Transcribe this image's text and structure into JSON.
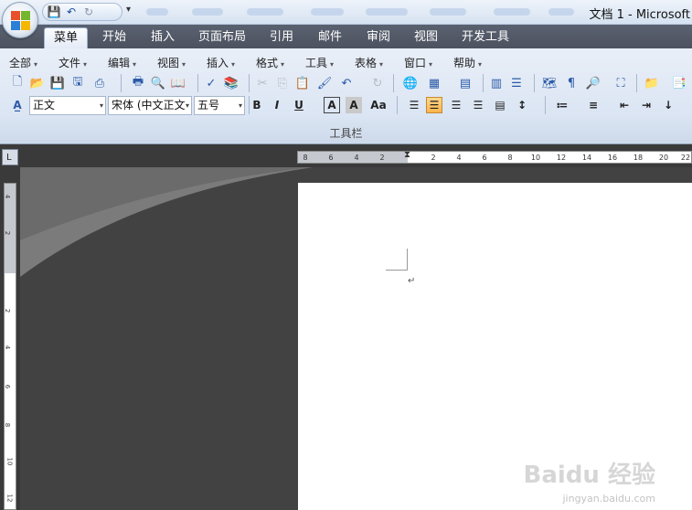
{
  "title_bar": {
    "window_title": "文档 1 - Microsoft",
    "qat_icons": [
      "save-icon",
      "undo-icon",
      "redo-icon"
    ]
  },
  "tabs": [
    {
      "label": "菜单",
      "active": true
    },
    {
      "label": "开始"
    },
    {
      "label": "插入"
    },
    {
      "label": "页面布局"
    },
    {
      "label": "引用"
    },
    {
      "label": "邮件"
    },
    {
      "label": "审阅"
    },
    {
      "label": "视图"
    },
    {
      "label": "开发工具"
    }
  ],
  "menu_row": [
    {
      "label": "全部"
    },
    {
      "label": "文件"
    },
    {
      "label": "编辑"
    },
    {
      "label": "视图"
    },
    {
      "label": "插入"
    },
    {
      "label": "格式"
    },
    {
      "label": "工具"
    },
    {
      "label": "表格"
    },
    {
      "label": "窗口"
    },
    {
      "label": "帮助"
    }
  ],
  "format_row": {
    "style_value": "正文",
    "font_value": "宋体 (中文正文",
    "size_value": "五号",
    "bold": "B",
    "italic": "I",
    "underline": "U",
    "char_border": "A",
    "char_shading": "A",
    "change_case": "Aa"
  },
  "group_label": "工具栏",
  "ruler": {
    "corner": "L",
    "h_ticks": [
      "8",
      "6",
      "4",
      "2",
      "2",
      "4",
      "6",
      "8",
      "10",
      "12",
      "14",
      "16",
      "18",
      "20",
      "22"
    ],
    "v_ticks": [
      "4",
      "2",
      "2",
      "2",
      "4",
      "6",
      "8",
      "10",
      "12"
    ]
  },
  "document": {
    "paragraph_mark": "↵"
  },
  "watermark": {
    "brand": "Baidu 经验",
    "url": "jingyan.baidu.com"
  },
  "colors": {
    "titlebar": "#dbe5f2",
    "tabbar": "#505665",
    "ribbon": "#dde6f3",
    "workspace": "#424242",
    "highlight": "#ffbf5e"
  }
}
